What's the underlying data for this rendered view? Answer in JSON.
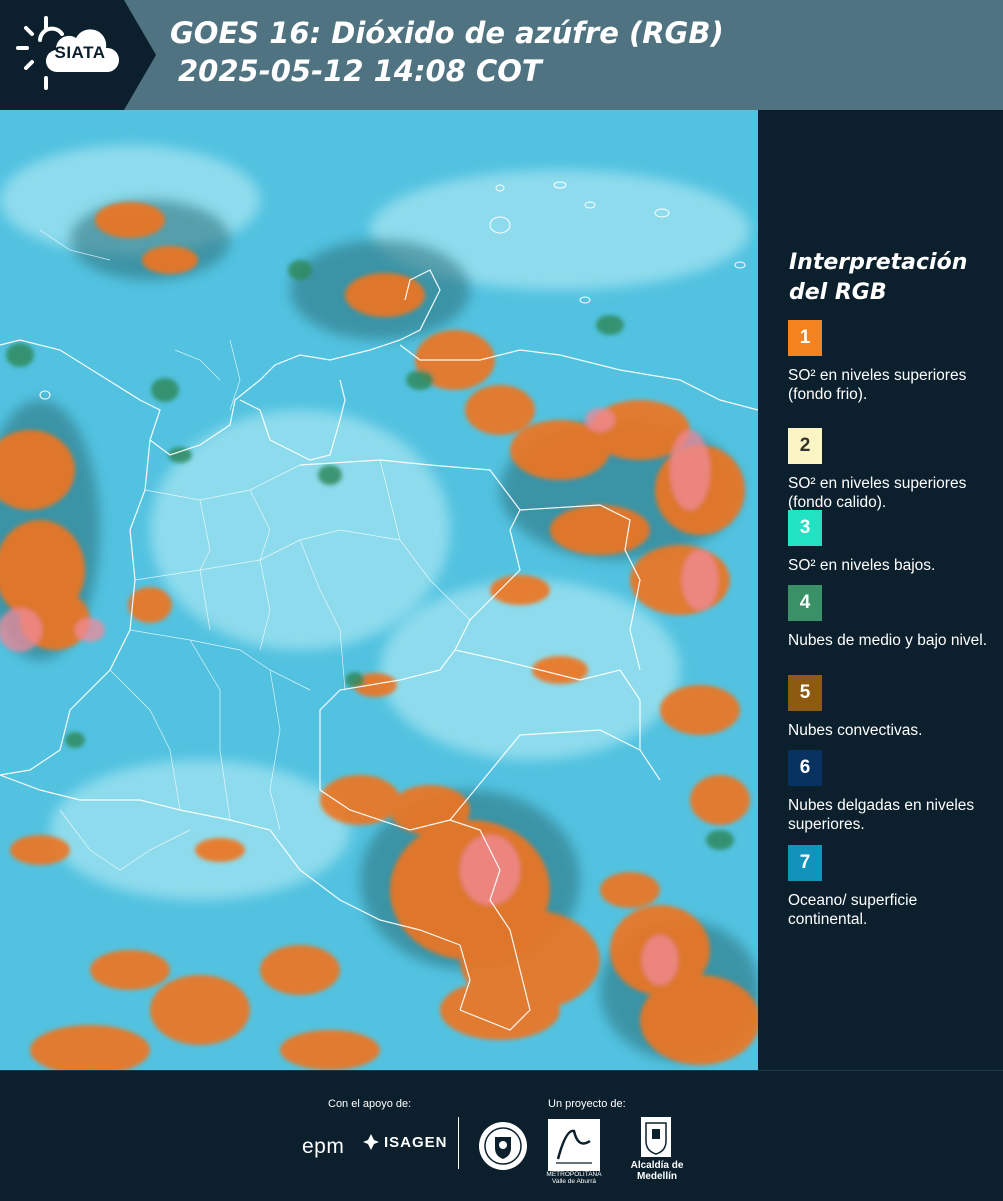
{
  "header": {
    "logo_text": "SIATA",
    "title_line1": "GOES 16: Dióxido de azúfre (RGB)",
    "title_line2": "2025-05-12 14:08 COT"
  },
  "legend": {
    "title": "Interpretación del RGB",
    "items": [
      {
        "number": "1",
        "color": "#f4831f",
        "text_color": "#ffffff",
        "description": "SO² en niveles superiores (fondo frio)."
      },
      {
        "number": "2",
        "color": "#fbf5c4",
        "text_color": "#333333",
        "description": "SO² en niveles superiores (fondo calido)."
      },
      {
        "number": "3",
        "color": "#21e3c3",
        "text_color": "#ffffff",
        "description": "SO² en niveles bajos."
      },
      {
        "number": "4",
        "color": "#3a9168",
        "text_color": "#ffffff",
        "description": "Nubes de medio y bajo nivel."
      },
      {
        "number": "5",
        "color": "#8e5a12",
        "text_color": "#ffffff",
        "description": "Nubes convectivas."
      },
      {
        "number": "6",
        "color": "#083360",
        "text_color": "#ffffff",
        "description": "Nubes delgadas en niveles superiores."
      },
      {
        "number": "7",
        "color": "#1293bb",
        "text_color": "#ffffff",
        "description": "Oceano/ superficie continental."
      }
    ]
  },
  "footer": {
    "support_label": "Con el apoyo de:",
    "project_label": "Un proyecto de:",
    "epm": "epm",
    "isagen": "ISAGEN",
    "area_metropolitana": "METROPOLITANA Valle de Aburrá",
    "alcaldia": "Alcaldía de Medellín"
  },
  "colors": {
    "header_bg": "#4f7381",
    "panel_bg": "#0b1f2c",
    "map_base": "#52c2e0",
    "cloud_orange": "#f0741e",
    "cloud_pink": "#f08a9a",
    "cloud_green": "#2f8a5e",
    "border_white": "#ffffff"
  }
}
